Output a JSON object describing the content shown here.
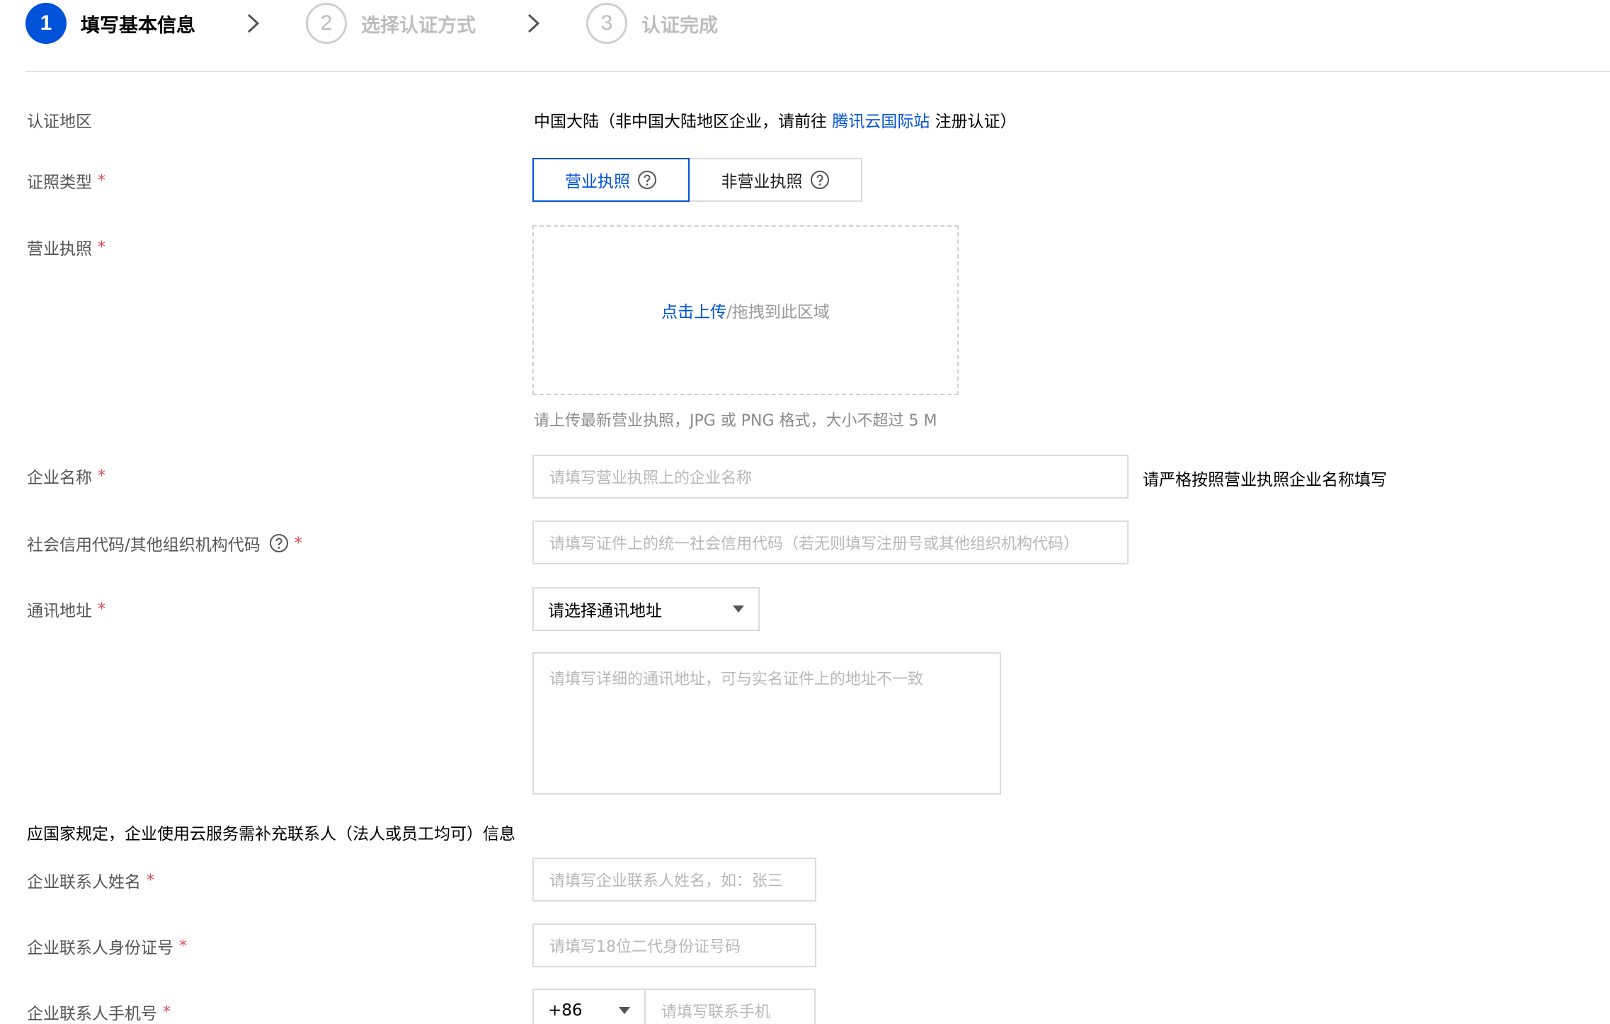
{
  "stepper": {
    "steps": [
      {
        "num": "1",
        "label": "填写基本信息",
        "state": "active"
      },
      {
        "num": "2",
        "label": "选择认证方式",
        "state": "idle"
      },
      {
        "num": "3",
        "label": "认证完成",
        "state": "idle"
      }
    ]
  },
  "region": {
    "label": "认证地区",
    "value_prefix": "中国大陆（非中国大陆地区企业，请前往 ",
    "link_text": "腾讯云国际站",
    "value_suffix": " 注册认证）"
  },
  "license_type": {
    "label": "证照类型",
    "required": "*",
    "options": [
      "营业执照",
      "非营业执照"
    ],
    "selected": "营业执照"
  },
  "license_upload": {
    "label": "营业执照",
    "required": "*",
    "upload_link": "点击上传",
    "upload_text": "/拖拽到此区域",
    "hint": "请上传最新营业执照，JPG 或 PNG 格式，大小不超过 5 M"
  },
  "company_name": {
    "label": "企业名称",
    "required": "*",
    "placeholder": "请填写营业执照上的企业名称",
    "note": "请严格按照营业执照企业名称填写"
  },
  "credit_code": {
    "label": "社会信用代码/其他组织机构代码",
    "required": "*",
    "placeholder": "请填写证件上的统一社会信用代码（若无则填写注册号或其他组织机构代码）"
  },
  "address": {
    "label": "通讯地址",
    "required": "*",
    "select_value": "请选择通讯地址",
    "detail_placeholder": "请填写详细的通讯地址，可与实名证件上的地址不一致"
  },
  "contact_section": {
    "note": "应国家规定，企业使用云服务需补充联系人（法人或员工均可）信息"
  },
  "contact_name": {
    "label": "企业联系人姓名",
    "required": "*",
    "placeholder": "请填写企业联系人姓名，如：张三"
  },
  "contact_id": {
    "label": "企业联系人身份证号",
    "required": "*",
    "placeholder": "请填写18位二代身份证号码"
  },
  "contact_phone": {
    "label": "企业联系人手机号",
    "required": "*",
    "country_code": "+86",
    "placeholder": "请填写联系手机"
  },
  "colors": {
    "primary": "#0052d9",
    "required": "#e34d59",
    "border": "#dcdcdc",
    "placeholder": "#b8b8b8"
  }
}
